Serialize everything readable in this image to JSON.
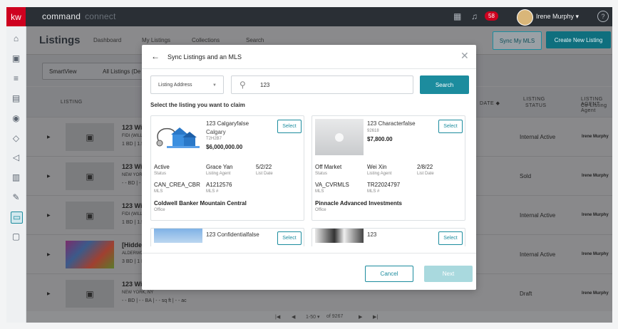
{
  "topbar": {
    "logo": "kw",
    "app_name": "command",
    "app_sub": "connect",
    "notification_count": "58",
    "user_name": "Irene Murphy",
    "user_caret": "▾",
    "help_icon": "?"
  },
  "page": {
    "title": "Listings",
    "tabs": [
      "Dashboard",
      "My Listings",
      "Collections",
      "Search"
    ],
    "sync_button": "Sync My MLS",
    "create_button": "Create New Listing",
    "smartview_label": "SmartView",
    "smartview_value": "All Listings (De",
    "columns": {
      "listing": "LISTING",
      "date": "DATE ◆",
      "status_line1": "LISTING",
      "status_line2": "STATUS",
      "agent_line1": "LISTING AGENT",
      "agent_line2": "Co-Listing Agent"
    },
    "rows": [
      {
        "title": "123 Will",
        "sub": "FIDI (WILL",
        "sub2": "1 BD | 1.5",
        "status": "Internal Active",
        "agent": "Irene Murphy"
      },
      {
        "title": "123 Will",
        "sub": "NEW YOR",
        "sub2": "- - BD | -",
        "status": "Sold",
        "agent": "Irene Murphy"
      },
      {
        "title": "123 Will",
        "sub": "FIDI (WILL",
        "sub2": "1 BD | 1.5",
        "status": "Internal Active",
        "agent": "Irene Murphy"
      },
      {
        "title": "[Hidden]",
        "sub": "ALDERWO",
        "sub2": "3 BD | 1 B",
        "status": "Internal Active",
        "agent": "Irene Murphy"
      },
      {
        "title": "123 Will",
        "sub": "NEW YORK, NY",
        "sub2": "- - BD | - - BA | - - sq ft | - - ac",
        "status": "Draft",
        "agent": "Irene Murphy"
      }
    ],
    "pager": {
      "range": "1-50 ▾",
      "of": "of 9267"
    }
  },
  "modal": {
    "title": "Sync Listings and an MLS",
    "search_type": "Listing Address",
    "search_value": "123",
    "search_button": "Search",
    "instruction": "Select the listing you want to claim",
    "select_label": "Select",
    "cards": [
      {
        "address": "123 Calgaryfalse",
        "city": "Calgary",
        "zip": "T2H2B7",
        "price": "$6,000,000.00",
        "status": "Active",
        "status_label": "Status",
        "agent": "Grace Yan",
        "agent_label": "Listing Agent",
        "list_date": "5/2/22",
        "list_date_label": "List Date",
        "mls": "CAN_CREA_CBR",
        "mls_label": "MLS",
        "mls_num": "A1212576",
        "mls_num_label": "MLS #",
        "office": "Coldwell Banker Mountain Central",
        "office_label": "Office"
      },
      {
        "address": "123 Characterfalse",
        "zip": "92618",
        "price": "$7,800.00",
        "status": "Off Market",
        "status_label": "Status",
        "agent": "Wei Xin",
        "agent_label": "Listing Agent",
        "list_date": "2/8/22",
        "list_date_label": "List Date",
        "mls": "VA_CVRMLS",
        "mls_label": "MLS",
        "mls_num": "TR22024797",
        "mls_num_label": "MLS #",
        "office": "Pinnacle Advanced Investments",
        "office_label": "Office"
      },
      {
        "address": "123 Confidentialfalse"
      },
      {
        "address": "123"
      }
    ],
    "cancel_button": "Cancel",
    "next_button": "Next"
  }
}
